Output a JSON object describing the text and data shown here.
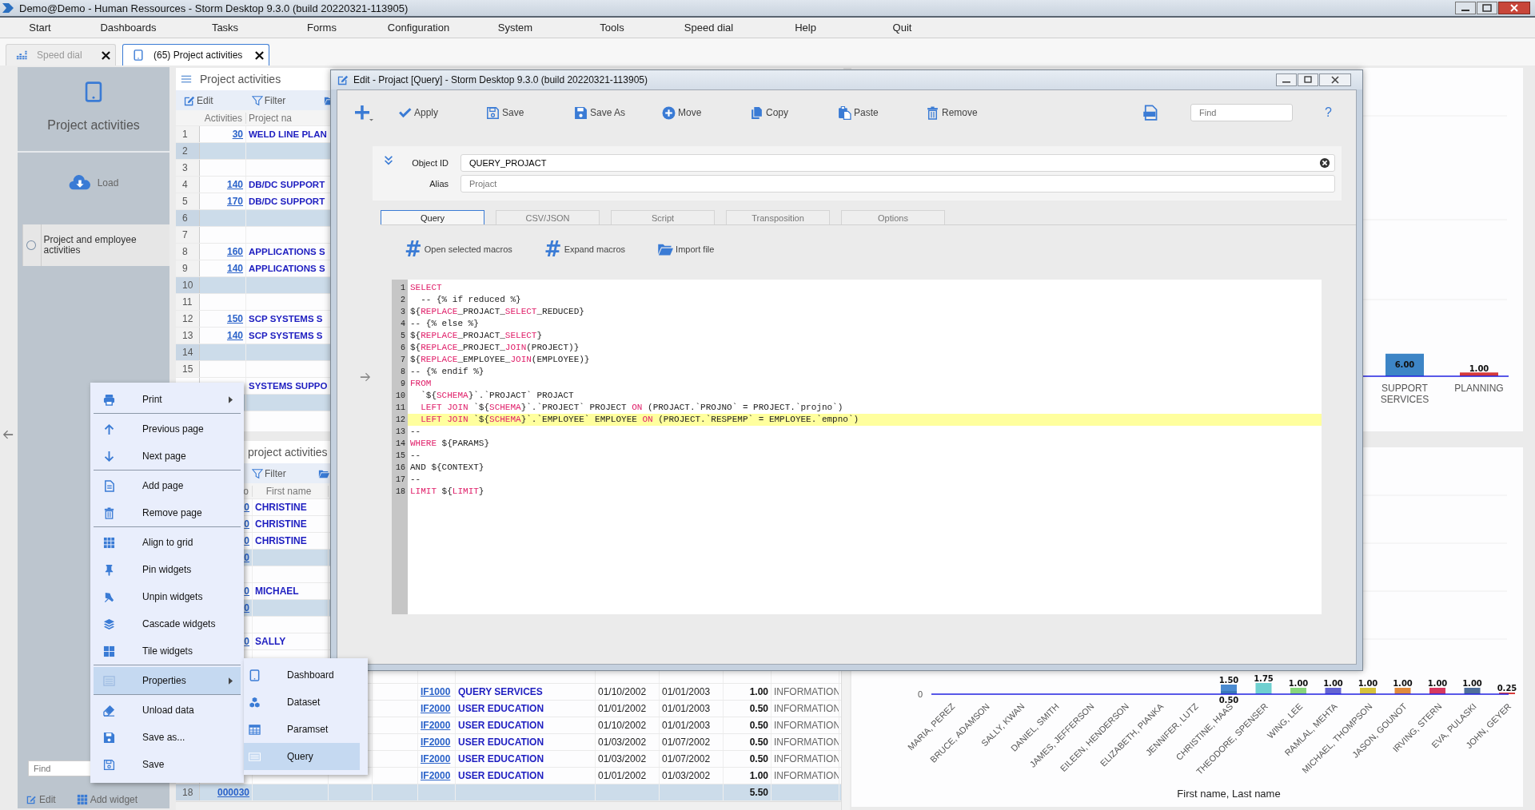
{
  "window": {
    "title": "Demo@Demo - Human Ressources -  Storm Desktop 9.3.0 (build 20220321-113905)"
  },
  "menu": [
    "Start",
    "Dashboards",
    "Tasks",
    "Forms",
    "Configuration",
    "System",
    "Tools",
    "Speed dial",
    "Help",
    "Quit"
  ],
  "tabs": [
    {
      "label": "Speed dial",
      "selected": false
    },
    {
      "label": "(65) Project activities",
      "selected": true
    }
  ],
  "sidebar": {
    "title": "Project activities",
    "load": "Load",
    "items": [
      {
        "label": "Project and employee activities",
        "selected": false
      }
    ],
    "find": {
      "placeholder": "Find"
    },
    "edit": "Edit",
    "add_widget": "Add widget"
  },
  "widget_top": {
    "title": "Project activities",
    "toolbar": [
      "Edit",
      "Filter"
    ],
    "columns": [
      "Activities",
      "Project na"
    ],
    "rows": [
      {
        "num": "1",
        "activities": "30",
        "project": "WELD LINE PLAN",
        "shaded": false
      },
      {
        "num": "2",
        "shaded": true
      },
      {
        "num": "3",
        "shaded": false
      },
      {
        "num": "4",
        "activities": "140",
        "project": "DB/DC SUPPORT",
        "shaded": false
      },
      {
        "num": "5",
        "activities": "170",
        "project": "DB/DC SUPPORT",
        "shaded": false
      },
      {
        "num": "6",
        "shaded": true
      },
      {
        "num": "7",
        "shaded": false
      },
      {
        "num": "8",
        "activities": "160",
        "project": "APPLICATIONS S",
        "shaded": false
      },
      {
        "num": "9",
        "activities": "140",
        "project": "APPLICATIONS S",
        "shaded": false
      },
      {
        "num": "10",
        "shaded": true
      },
      {
        "num": "11",
        "shaded": false
      },
      {
        "num": "12",
        "activities": "150",
        "project": "SCP SYSTEMS S",
        "shaded": false
      },
      {
        "num": "13",
        "activities": "140",
        "project": "SCP SYSTEMS S",
        "shaded": false
      },
      {
        "num": "14",
        "shaded": true
      },
      {
        "num": "15",
        "shaded": false
      },
      {
        "project": "SYSTEMS SUPPO",
        "shaded": false
      },
      {
        "shaded": true
      }
    ]
  },
  "widget_bottom": {
    "title": "project activities",
    "toolbar": [
      "Filter"
    ],
    "columns": [
      "o",
      "First name"
    ],
    "rows": [
      {
        "no": "0",
        "first": "CHRISTINE",
        "shaded": false
      },
      {
        "no": "0",
        "first": "CHRISTINE",
        "shaded": false
      },
      {
        "no": "0",
        "first": "CHRISTINE",
        "shaded": false
      },
      {
        "no": "0",
        "shaded": true
      },
      {
        "shaded": false
      },
      {
        "no": "0",
        "first": "MICHAEL",
        "shaded": false
      },
      {
        "no": "0",
        "shaded": true
      },
      {
        "shaded": false
      },
      {
        "no": "0",
        "first": "SALLY",
        "shaded": false
      },
      {
        "shaded": false
      },
      {
        "shaded": false
      },
      {
        "pno": "IF1000",
        "pname": "QUERY SERVICES",
        "start": "01/10/2002",
        "end": "01/01/2003",
        "hours": "1.00",
        "dept": "INFORMATION",
        "shaded": false
      },
      {
        "pno": "IF2000",
        "pname": "USER EDUCATION",
        "start": "01/01/2002",
        "end": "01/01/2003",
        "hours": "0.50",
        "dept": "INFORMATION",
        "shaded": false
      },
      {
        "pno": "IF2000",
        "pname": "USER EDUCATION",
        "start": "01/10/2002",
        "end": "01/01/2003",
        "hours": "0.50",
        "dept": "INFORMATION",
        "shaded": false
      },
      {
        "pno": "IF2000",
        "pname": "USER EDUCATION",
        "start": "01/03/2002",
        "end": "01/07/2002",
        "hours": "0.50",
        "dept": "INFORMATION",
        "shaded": false
      },
      {
        "pno": "IF2000",
        "pname": "USER EDUCATION",
        "start": "01/03/2002",
        "end": "01/07/2002",
        "hours": "0.50",
        "dept": "INFORMATION",
        "shaded": false
      },
      {
        "pno": "IF2000",
        "pname": "USER EDUCATION",
        "start": "01/01/2002",
        "end": "01/03/2002",
        "hours": "1.00",
        "dept": "INFORMATION",
        "shaded": false
      },
      {
        "num": "18",
        "no": "000030",
        "hours": "5.50",
        "shaded": true
      }
    ]
  },
  "chart_top": {
    "chart_data": {
      "type": "bar",
      "categories": [
        "SUPPORT SERVICES",
        "PLANNING"
      ],
      "series": [
        {
          "colors": [
            "#3d85c6",
            "#d63a3a"
          ],
          "values": [
            6,
            1
          ],
          "value_labels": [
            "6.00",
            "1.00"
          ]
        }
      ],
      "data_labels": true
    }
  },
  "chart_bottom": {
    "zero_tick": "0",
    "chart_data": {
      "type": "bar",
      "xlabel": "First name, Last name",
      "categories": [
        "MARIA, PEREZ",
        "BRUCE, ADAMSON",
        "SALLY, KWAN",
        "DANIEL, SMITH",
        "JAMES, JEFFERSON",
        "EILEEN, HENDERSON",
        "ELIZABETH, PIANKA",
        "JENNIFER, LUTZ",
        "CHRISTINE, HAAS",
        "THEODORE, SPENSER",
        "WING, LEE",
        "RAMLAL, MEHTA",
        "MICHAEL, THOMPSON",
        "JASON, GOUNOT",
        "IRVING, STERN",
        "EVA, PULASKI",
        "JOHN, GEYER"
      ],
      "series": [
        {
          "colors": [
            null,
            null,
            null,
            null,
            null,
            null,
            null,
            null,
            "#4a8ad0",
            "#6fd0d0",
            "#88d67a",
            "#6464d2",
            "#d6c23a",
            "#e08a3c",
            "#d6395f",
            "#4f6f99",
            "#d63a3a"
          ],
          "values": [
            null,
            null,
            null,
            null,
            null,
            null,
            null,
            null,
            1.5,
            1.75,
            1,
            1,
            1,
            1,
            1,
            1,
            0.25
          ],
          "value_labels": [
            null,
            null,
            null,
            null,
            null,
            null,
            null,
            null,
            "1.50",
            "1.75",
            "1.00",
            "1.00",
            "1.00",
            "1.00",
            "1.00",
            "1.00",
            "0.25"
          ]
        },
        {
          "color": "#3a78b8",
          "values": [
            null,
            null,
            null,
            null,
            null,
            null,
            null,
            null,
            0.5,
            null,
            null,
            null,
            null,
            null,
            null,
            null,
            null
          ],
          "value_labels": [
            null,
            null,
            null,
            null,
            null,
            null,
            null,
            null,
            "0.50",
            null,
            null,
            null,
            null,
            null,
            null,
            null,
            null
          ]
        }
      ],
      "data_labels": true
    }
  },
  "dialog": {
    "title": "Edit - Projact [Query] -  Storm Desktop 9.3.0 (build 20220321-113905)",
    "toolbar": [
      "Apply",
      "Save",
      "Save As",
      "Move",
      "Copy",
      "Paste",
      "Remove"
    ],
    "find": {
      "placeholder": "Find"
    },
    "help": "?",
    "object_id": {
      "label": "Object ID",
      "value": "QUERY_PROJACT"
    },
    "alias": {
      "label": "Alias",
      "placeholder": "Projact"
    },
    "tabs": [
      {
        "label": "Query",
        "selected": true
      },
      {
        "label": "CSV/JSON",
        "selected": false
      },
      {
        "label": "Script",
        "selected": false
      },
      {
        "label": "Transposition",
        "selected": false
      },
      {
        "label": "Options",
        "selected": false
      }
    ],
    "macros": [
      {
        "glyph": "#",
        "label": "Open selected macros"
      },
      {
        "glyph": "#",
        "label": "Expand macros"
      },
      {
        "label": "Import file"
      }
    ],
    "code": [
      {
        "num": "1",
        "highlighted": false,
        "tokens": [
          {
            "kind": "keyword",
            "text": "SELECT"
          }
        ]
      },
      {
        "num": "2",
        "highlighted": false,
        "tokens": [
          {
            "kind": "plain",
            "text": "  -- {% if reduced %}"
          }
        ]
      },
      {
        "num": "3",
        "highlighted": false,
        "tokens": [
          {
            "kind": "plain",
            "text": "${"
          },
          {
            "kind": "keyword",
            "text": "REPLACE"
          },
          {
            "kind": "plain",
            "text": "_PROJACT_"
          },
          {
            "kind": "keyword",
            "text": "SELECT"
          },
          {
            "kind": "plain",
            "text": "_REDUCED}"
          }
        ]
      },
      {
        "num": "4",
        "highlighted": false,
        "tokens": [
          {
            "kind": "plain",
            "text": "-- {% else %}"
          }
        ]
      },
      {
        "num": "5",
        "highlighted": false,
        "tokens": [
          {
            "kind": "plain",
            "text": "${"
          },
          {
            "kind": "keyword",
            "text": "REPLACE"
          },
          {
            "kind": "plain",
            "text": "_PROJACT_"
          },
          {
            "kind": "keyword",
            "text": "SELECT"
          },
          {
            "kind": "plain",
            "text": "}"
          }
        ]
      },
      {
        "num": "6",
        "highlighted": false,
        "tokens": [
          {
            "kind": "plain",
            "text": "${"
          },
          {
            "kind": "keyword",
            "text": "REPLACE"
          },
          {
            "kind": "plain",
            "text": "_PROJECT_"
          },
          {
            "kind": "keyword",
            "text": "JOIN"
          },
          {
            "kind": "plain",
            "text": "(PROJECT)}"
          }
        ]
      },
      {
        "num": "7",
        "highlighted": false,
        "tokens": [
          {
            "kind": "plain",
            "text": "${"
          },
          {
            "kind": "keyword",
            "text": "REPLACE"
          },
          {
            "kind": "plain",
            "text": "_EMPLOYEE_"
          },
          {
            "kind": "keyword",
            "text": "JOIN"
          },
          {
            "kind": "plain",
            "text": "(EMPLOYEE)}"
          }
        ]
      },
      {
        "num": "8",
        "highlighted": false,
        "tokens": [
          {
            "kind": "plain",
            "text": "-- {% endif %}"
          }
        ]
      },
      {
        "num": "9",
        "highlighted": false,
        "tokens": [
          {
            "kind": "keyword",
            "text": "FROM"
          }
        ]
      },
      {
        "num": "10",
        "highlighted": false,
        "tokens": [
          {
            "kind": "plain",
            "text": "  `${"
          },
          {
            "kind": "keyword",
            "text": "SCHEMA"
          },
          {
            "kind": "plain",
            "text": "}`.`PROJACT` PROJACT"
          }
        ]
      },
      {
        "num": "11",
        "highlighted": false,
        "tokens": [
          {
            "kind": "keyword",
            "text": "  LEFT JOIN"
          },
          {
            "kind": "plain",
            "text": " `${"
          },
          {
            "kind": "keyword",
            "text": "SCHEMA"
          },
          {
            "kind": "plain",
            "text": "}`.`PROJECT` PROJECT "
          },
          {
            "kind": "keyword",
            "text": "ON"
          },
          {
            "kind": "plain",
            "text": " (PROJACT.`PROJNO` = PROJECT.`projno`)"
          }
        ]
      },
      {
        "num": "12",
        "highlighted": true,
        "tokens": [
          {
            "kind": "keyword",
            "text": "  LEFT JOIN"
          },
          {
            "kind": "plain",
            "text": " `${"
          },
          {
            "kind": "keyword",
            "text": "SCHEMA"
          },
          {
            "kind": "plain",
            "text": "}`.`EMPLOYEE` EMPLOYEE "
          },
          {
            "kind": "keyword",
            "text": "ON"
          },
          {
            "kind": "plain",
            "text": " (PROJECT.`RESPEMP` = EMPLOYEE.`empno`)"
          }
        ]
      },
      {
        "num": "13",
        "highlighted": false,
        "tokens": [
          {
            "kind": "plain",
            "text": "--"
          }
        ]
      },
      {
        "num": "14",
        "highlighted": false,
        "tokens": [
          {
            "kind": "keyword",
            "text": "WHERE"
          },
          {
            "kind": "plain",
            "text": " ${PARAMS}"
          }
        ]
      },
      {
        "num": "15",
        "highlighted": false,
        "tokens": [
          {
            "kind": "plain",
            "text": "--"
          }
        ]
      },
      {
        "num": "16",
        "highlighted": false,
        "tokens": [
          {
            "kind": "plain",
            "text": "AND ${CONTEXT}"
          }
        ]
      },
      {
        "num": "17",
        "highlighted": false,
        "tokens": [
          {
            "kind": "plain",
            "text": "--"
          }
        ]
      },
      {
        "num": "18",
        "highlighted": false,
        "tokens": [
          {
            "kind": "keyword",
            "text": "LIMIT"
          },
          {
            "kind": "plain",
            "text": " ${"
          },
          {
            "kind": "keyword",
            "text": "LIMIT"
          },
          {
            "kind": "plain",
            "text": "}"
          }
        ]
      }
    ]
  },
  "context_menu": {
    "items": [
      {
        "label": "Print",
        "submenu": true,
        "selected": false,
        "separator_after": true
      },
      {
        "label": "Previous page",
        "submenu": false,
        "selected": false,
        "separator_after": false
      },
      {
        "label": "Next page",
        "submenu": false,
        "selected": false,
        "separator_after": true
      },
      {
        "label": "Add page",
        "submenu": false,
        "selected": false,
        "separator_after": false
      },
      {
        "label": "Remove page",
        "submenu": false,
        "selected": false,
        "separator_after": true
      },
      {
        "label": "Align to grid",
        "submenu": false,
        "selected": false,
        "separator_after": false
      },
      {
        "label": "Pin widgets",
        "submenu": false,
        "selected": false,
        "separator_after": false
      },
      {
        "label": "Unpin widgets",
        "submenu": false,
        "selected": false,
        "separator_after": false
      },
      {
        "label": "Cascade widgets",
        "submenu": false,
        "selected": false,
        "separator_after": false
      },
      {
        "label": "Tile widgets",
        "submenu": false,
        "selected": false,
        "separator_after": true
      },
      {
        "label": "Properties",
        "submenu": true,
        "selected": true,
        "separator_after": true
      },
      {
        "label": "Unload data",
        "submenu": false,
        "selected": false,
        "separator_after": false
      },
      {
        "label": "Save as...",
        "submenu": false,
        "selected": false,
        "separator_after": false
      },
      {
        "label": "Save",
        "submenu": false,
        "selected": false,
        "separator_after": false
      }
    ],
    "submenu": [
      {
        "label": "Dashboard",
        "selected": false
      },
      {
        "label": "Dataset",
        "selected": false
      },
      {
        "label": "Paramset",
        "selected": false
      },
      {
        "label": "Query",
        "selected": true
      }
    ]
  }
}
